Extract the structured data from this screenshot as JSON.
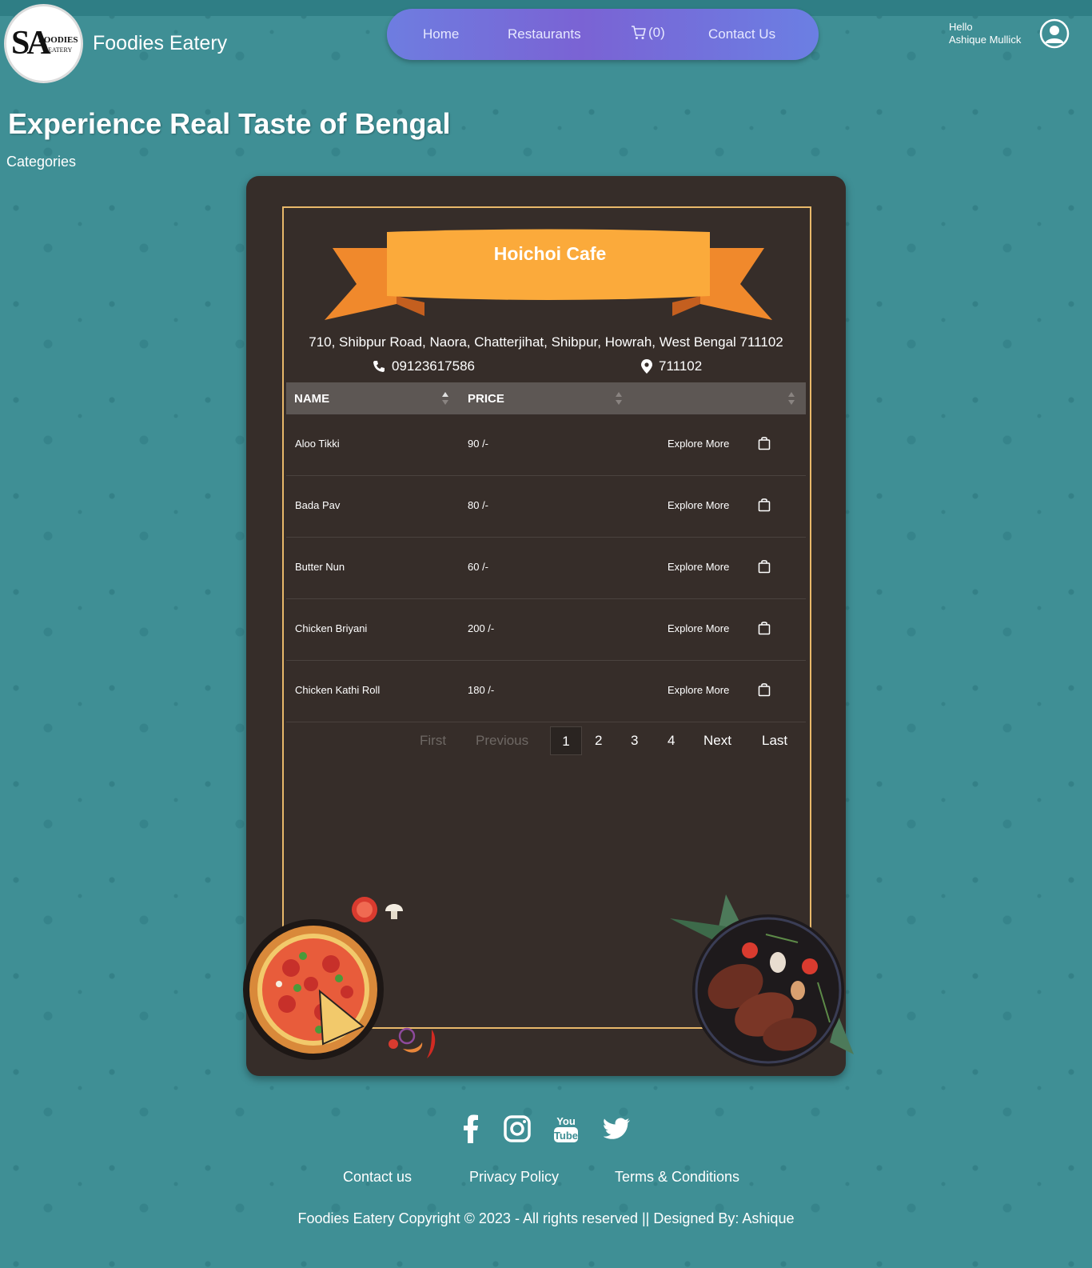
{
  "brand": {
    "logo_monogram": "SA",
    "logo_word1": "FOODIES",
    "logo_word2": "EATERY",
    "name": "Foodies Eatery"
  },
  "nav": {
    "home": "Home",
    "restaurants": "Restaurants",
    "cart_count": "(0)",
    "contact": "Contact Us"
  },
  "user": {
    "greeting": "Hello",
    "name": "Ashique Mullick"
  },
  "page": {
    "title": "Experience Real Taste of Bengal",
    "categories": "Categories"
  },
  "restaurant": {
    "name": "Hoichoi Cafe",
    "address": "710, Shibpur Road, Naora, Chatterjihat, Shibpur, Howrah, West Bengal 711102",
    "phone": "09123617586",
    "pincode": "711102"
  },
  "table": {
    "headers": [
      "NAME",
      "PRICE",
      ""
    ],
    "rows": [
      {
        "name": "Aloo Tikki",
        "price": "90 /-",
        "action": "Explore More"
      },
      {
        "name": "Bada Pav",
        "price": "80 /-",
        "action": "Explore More"
      },
      {
        "name": "Butter Nun",
        "price": "60 /-",
        "action": "Explore More"
      },
      {
        "name": "Chicken Briyani",
        "price": "200 /-",
        "action": "Explore More"
      },
      {
        "name": "Chicken Kathi Roll",
        "price": "180 /-",
        "action": "Explore More"
      }
    ]
  },
  "pagination": {
    "first": "First",
    "previous": "Previous",
    "pages": [
      "1",
      "2",
      "3",
      "4"
    ],
    "current": "1",
    "next": "Next",
    "last": "Last"
  },
  "footer": {
    "social": [
      "facebook-icon",
      "instagram-icon",
      "youtube-icon",
      "twitter-icon"
    ],
    "youtube_you": "You",
    "youtube_tube": "Tube",
    "links": [
      "Contact us",
      "Privacy Policy",
      "Terms & Conditions"
    ],
    "copyright": "Foodies Eatery Copyright © 2023 - All rights reserved || Designed By: Ashique"
  },
  "colors": {
    "background": "#3f8f95",
    "card": "#362d29",
    "ribbon": "#fbaa3b",
    "ribbon_tail": "#f0892c",
    "frame": "#e8b86a",
    "nav_gradient_start": "#6e7de0",
    "nav_gradient_mid": "#7a63d4"
  }
}
